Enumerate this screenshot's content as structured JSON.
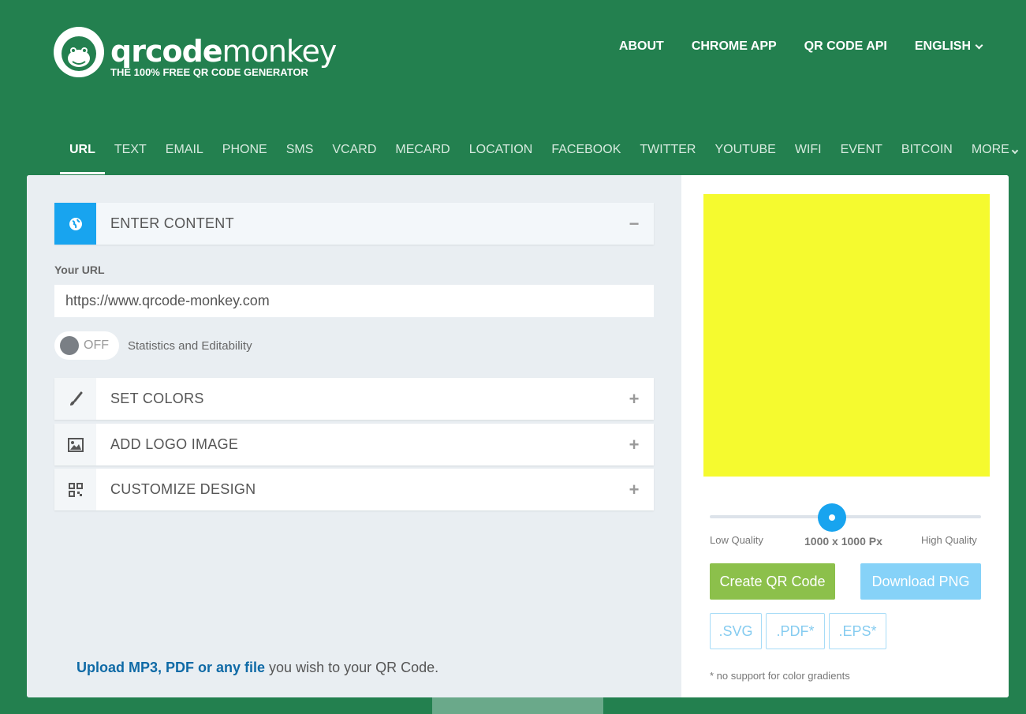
{
  "brand": {
    "name_bold": "qrcode",
    "name_light": "monkey",
    "tagline": "THE 100% FREE QR CODE GENERATOR"
  },
  "topnav": {
    "about": "ABOUT",
    "chrome_app": "CHROME APP",
    "api": "QR CODE API",
    "language": "ENGLISH"
  },
  "tabs": [
    {
      "label": "URL",
      "active": true
    },
    {
      "label": "TEXT"
    },
    {
      "label": "EMAIL"
    },
    {
      "label": "PHONE"
    },
    {
      "label": "SMS"
    },
    {
      "label": "VCARD"
    },
    {
      "label": "MECARD"
    },
    {
      "label": "LOCATION"
    },
    {
      "label": "FACEBOOK"
    },
    {
      "label": "TWITTER"
    },
    {
      "label": "YOUTUBE"
    },
    {
      "label": "WIFI"
    },
    {
      "label": "EVENT"
    },
    {
      "label": "BITCOIN"
    },
    {
      "label": "MORE"
    }
  ],
  "panels": {
    "content": {
      "title": "ENTER CONTENT",
      "toggle": "−"
    },
    "colors": {
      "title": "SET COLORS",
      "toggle": "+"
    },
    "logo": {
      "title": "ADD LOGO IMAGE",
      "toggle": "+"
    },
    "design": {
      "title": "CUSTOMIZE DESIGN",
      "toggle": "+"
    }
  },
  "url_form": {
    "label": "Your URL",
    "value": "https://www.qrcode-monkey.com"
  },
  "stats_switch": {
    "state": "OFF",
    "label": "Statistics and Editability"
  },
  "upload": {
    "link": "Upload MP3, PDF or any file",
    "rest": " you wish to your QR Code."
  },
  "preview": {
    "color": "#f5fa2f"
  },
  "quality": {
    "low": "Low Quality",
    "size": "1000 x 1000 Px",
    "high": "High Quality",
    "level": 0.45
  },
  "actions": {
    "create": "Create QR Code",
    "download": "Download PNG",
    "svg": ".SVG",
    "pdf": ".PDF*",
    "eps": ".EPS*",
    "note": "* no support for color gradients"
  },
  "colors": {
    "background": "#23804f",
    "accent_blue": "#18a4ef",
    "create_green": "#8cc04b"
  }
}
